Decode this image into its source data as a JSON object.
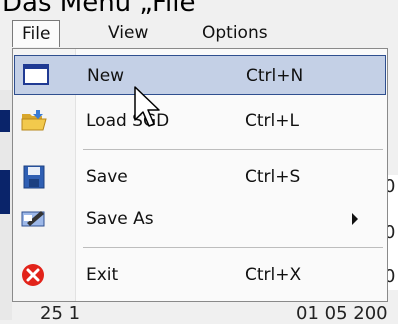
{
  "caption": "Das Menü „File\"",
  "menubar": {
    "file": "File",
    "view": "View",
    "options": "Options"
  },
  "menu": {
    "items": [
      {
        "label": "New",
        "shortcut": "Ctrl+N"
      },
      {
        "label": "Load SGD",
        "shortcut": "Ctrl+L"
      },
      {
        "label": "Save",
        "shortcut": "Ctrl+S"
      },
      {
        "label": "Save As",
        "shortcut": ""
      },
      {
        "label": "Exit",
        "shortcut": "Ctrl+X"
      }
    ]
  },
  "background": {
    "right_fragments": [
      "0",
      "0",
      "0"
    ],
    "bottom_row": [
      "25 1",
      "01 05 200"
    ]
  },
  "colors": {
    "highlight": "#c4d0e6",
    "highlight_border": "#2f4f8f",
    "exit_red": "#e2231a"
  }
}
